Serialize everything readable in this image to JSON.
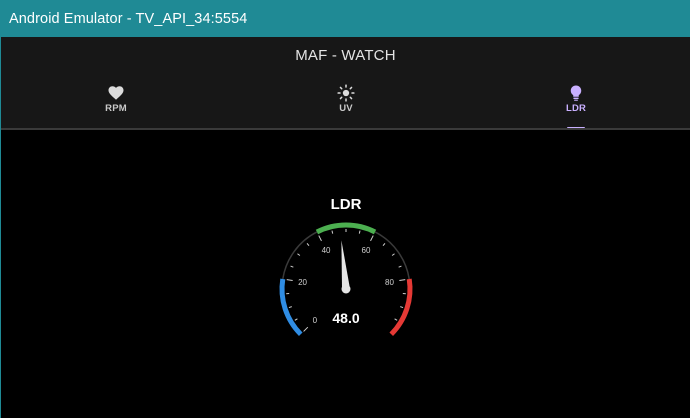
{
  "window": {
    "title": "Android Emulator - TV_API_34:5554"
  },
  "app": {
    "title": "MAF - WATCH"
  },
  "tabs": [
    {
      "label": "RPM",
      "icon": "heart-icon"
    },
    {
      "label": "UV",
      "icon": "sun-icon"
    },
    {
      "label": "LDR",
      "icon": "lightbulb-icon",
      "active": true
    }
  ],
  "gauge": {
    "title": "LDR",
    "value": 48.0,
    "value_text": "48.0",
    "min": 0,
    "max": 100,
    "ticks": [
      "0",
      "20",
      "40",
      "60",
      "80"
    ],
    "zones": [
      {
        "from": 0,
        "to": 20,
        "color": "#2f8de4"
      },
      {
        "from": 20,
        "to": 40,
        "color": "#3a3a3a"
      },
      {
        "from": 40,
        "to": 60,
        "color": "#4caf50"
      },
      {
        "from": 60,
        "to": 80,
        "color": "#3a3a3a"
      },
      {
        "from": 80,
        "to": 100,
        "color": "#e53935"
      }
    ],
    "colors": {
      "needle": "#e6e6e6",
      "text": "#ffffff",
      "tick": "#cfcfcf"
    }
  }
}
